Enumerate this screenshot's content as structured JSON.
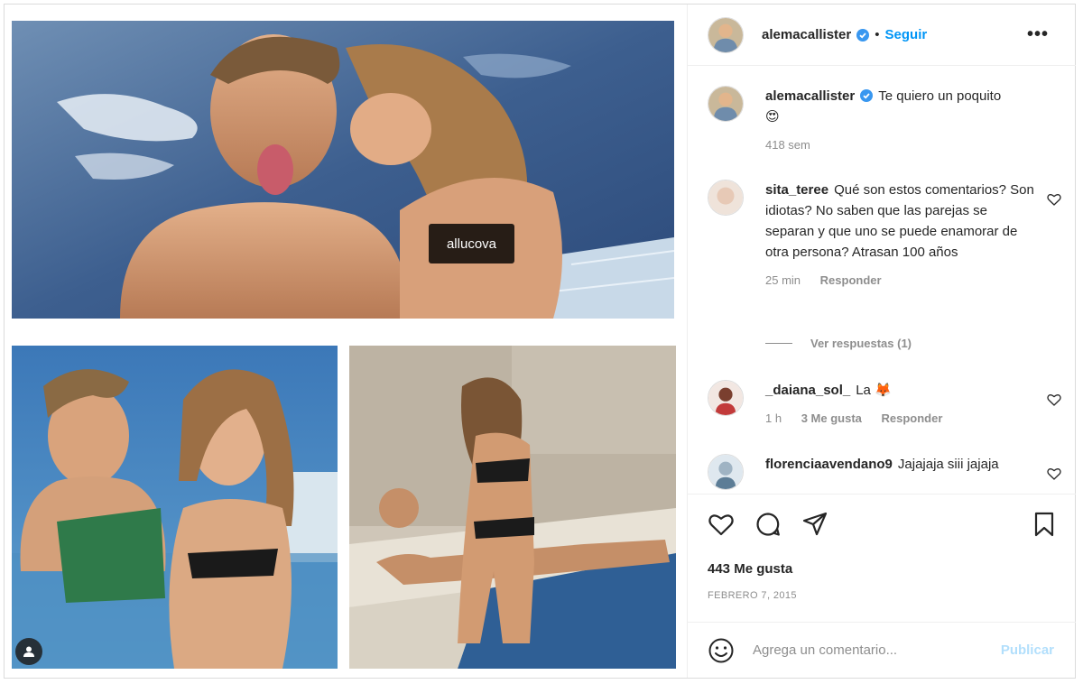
{
  "header": {
    "username": "alemacallister",
    "follow_label": "Seguir",
    "separator": "•",
    "more_label": "•••"
  },
  "media": {
    "tag_label": "allucova"
  },
  "caption": {
    "username": "alemacallister",
    "text": "Te quiero un poquito",
    "emoji": "😍",
    "time": "418 sem"
  },
  "comments": [
    {
      "username": "sita_teree",
      "text": "Qué son estos comentarios? Son idiotas? No saben que las parejas se separan y que uno se puede enamorar de otra persona? Atrasan 100 años",
      "time": "25 min",
      "reply_label": "Responder"
    },
    {
      "username": "_daiana_sol_",
      "text": "La",
      "emoji": "🦊",
      "time": "1 h",
      "likes": "3 Me gusta",
      "reply_label": "Responder"
    },
    {
      "username": "florenciaavendano9",
      "text": "Jajajaja siii jajaja"
    }
  ],
  "view_replies_label": "Ver respuestas (1)",
  "stats": {
    "likes": "443 Me gusta",
    "date": "FEBRERO 7, 2015"
  },
  "add_comment": {
    "placeholder": "Agrega un comentario...",
    "publish_label": "Publicar"
  },
  "colors": {
    "accent": "#0095f6",
    "publish_disabled": "#b2dffc",
    "muted": "#8e8e8e"
  },
  "icons": [
    "verified-icon",
    "more-icon",
    "heart-icon",
    "comment-icon",
    "share-icon",
    "bookmark-icon",
    "emoji-icon",
    "user-tag-icon"
  ]
}
